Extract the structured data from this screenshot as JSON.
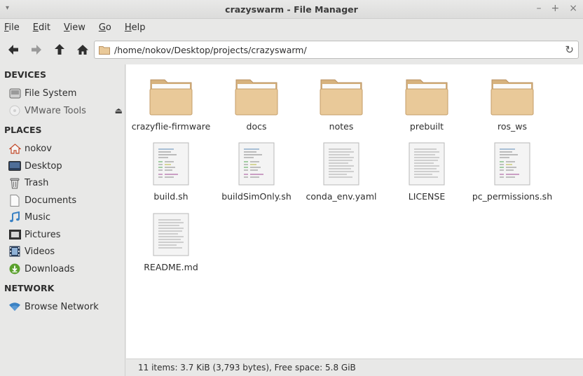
{
  "window": {
    "title": "crazyswarm - File Manager",
    "menu_glyph": "▾",
    "controls": {
      "minimize": "–",
      "maximize": "+",
      "close": "×"
    }
  },
  "menubar": {
    "file": "File",
    "edit": "Edit",
    "view": "View",
    "go": "Go",
    "help": "Help"
  },
  "toolbar": {
    "back_icon": "arrow-left-icon",
    "forward_icon": "arrow-right-icon",
    "up_icon": "arrow-up-icon",
    "home_icon": "home-icon",
    "location": "/home/nokov/Desktop/projects/crazyswarm/",
    "reload_glyph": "↻"
  },
  "sidebar": {
    "devices_header": "DEVICES",
    "devices": [
      {
        "label": "File System",
        "icon": "drive-icon"
      },
      {
        "label": "VMware Tools",
        "icon": "disc-icon",
        "eject": "⏏"
      }
    ],
    "places_header": "PLACES",
    "places": [
      {
        "label": "nokov",
        "icon": "home-icon"
      },
      {
        "label": "Desktop",
        "icon": "desktop-icon"
      },
      {
        "label": "Trash",
        "icon": "trash-icon"
      },
      {
        "label": "Documents",
        "icon": "document-icon"
      },
      {
        "label": "Music",
        "icon": "music-icon"
      },
      {
        "label": "Pictures",
        "icon": "pictures-icon"
      },
      {
        "label": "Videos",
        "icon": "videos-icon"
      },
      {
        "label": "Downloads",
        "icon": "downloads-icon"
      }
    ],
    "network_header": "NETWORK",
    "network": [
      {
        "label": "Browse Network",
        "icon": "wifi-icon"
      }
    ]
  },
  "files": [
    {
      "name": "crazyflie-firmware",
      "type": "folder"
    },
    {
      "name": "docs",
      "type": "folder"
    },
    {
      "name": "notes",
      "type": "folder"
    },
    {
      "name": "prebuilt",
      "type": "folder"
    },
    {
      "name": "ros_ws",
      "type": "folder"
    },
    {
      "name": "build.sh",
      "type": "script"
    },
    {
      "name": "buildSimOnly.sh",
      "type": "script"
    },
    {
      "name": "conda_env.yaml",
      "type": "text"
    },
    {
      "name": "LICENSE",
      "type": "text"
    },
    {
      "name": "pc_permissions.sh",
      "type": "script"
    },
    {
      "name": "README.md",
      "type": "text"
    }
  ],
  "status": "11 items: 3.7 KiB (3,793 bytes), Free space: 5.8 GiB",
  "colors": {
    "folder": "#e9c999",
    "accent_blue": "#3b82c4",
    "downloads_green": "#5aa02c"
  }
}
